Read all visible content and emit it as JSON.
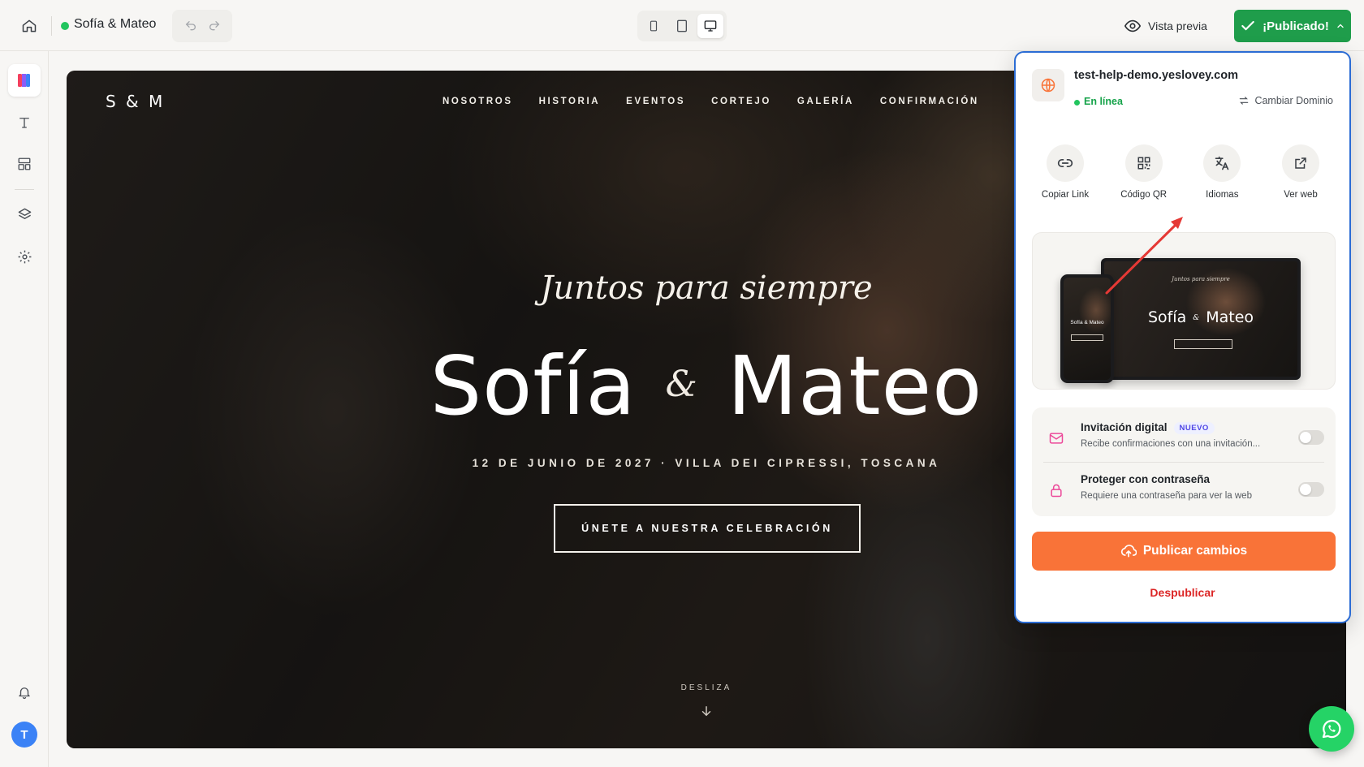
{
  "topbar": {
    "site_name": "Sofía & Mateo",
    "preview_label": "Vista previa",
    "published_label": "¡Publicado!"
  },
  "sidebar": {
    "items": [
      {
        "icon": "palette-icon"
      },
      {
        "icon": "text-icon"
      },
      {
        "icon": "sections-icon"
      },
      {
        "icon": "layers-icon"
      },
      {
        "icon": "settings-icon"
      }
    ],
    "notifications_icon": "bell-icon",
    "avatar_letter": "T"
  },
  "hero": {
    "logo": "S & M",
    "nav": [
      "NOSOTROS",
      "HISTORIA",
      "EVENTOS",
      "CORTEJO",
      "GALERÍA",
      "CONFIRMACIÓN"
    ],
    "script_title": "Juntos para siempre",
    "name_1": "Sofía",
    "ampersand": "&",
    "name_2": "Mateo",
    "date_location": "12 DE JUNIO DE 2027 · VILLA DEI CIPRESSI, TOSCANA",
    "cta": "ÚNETE A NUESTRA CELEBRACIÓN",
    "scroll_hint": "DESLIZA"
  },
  "panel": {
    "domain": "test-help-demo.yeslovey.com",
    "status": "En línea",
    "change_domain": "Cambiar Dominio",
    "actions": [
      {
        "label": "Copiar Link",
        "icon": "link-icon"
      },
      {
        "label": "Código QR",
        "icon": "qr-code-icon"
      },
      {
        "label": "Idiomas",
        "icon": "translate-icon"
      },
      {
        "label": "Ver web",
        "icon": "external-link-icon"
      }
    ],
    "mockup": {
      "script": "Juntos para siempre",
      "name_1": "Sofía",
      "ampersand": "&",
      "name_2": "Mateo",
      "phone_names": "Sofía & Mateo"
    },
    "options": [
      {
        "title": "Invitación digital",
        "badge": "NUEVO",
        "description": "Recibe confirmaciones con una invitación...",
        "enabled": false
      },
      {
        "title": "Proteger con contraseña",
        "description": "Requiere una contraseña para ver la web",
        "enabled": false
      }
    ],
    "publish_label": "Publicar cambios",
    "unpublish_label": "Despublicar"
  },
  "colors": {
    "published_green": "#1f9d4b",
    "publish_orange": "#f97338",
    "unpublish_red": "#dc2626",
    "panel_border": "#2b6cd4",
    "whatsapp": "#25d366"
  }
}
